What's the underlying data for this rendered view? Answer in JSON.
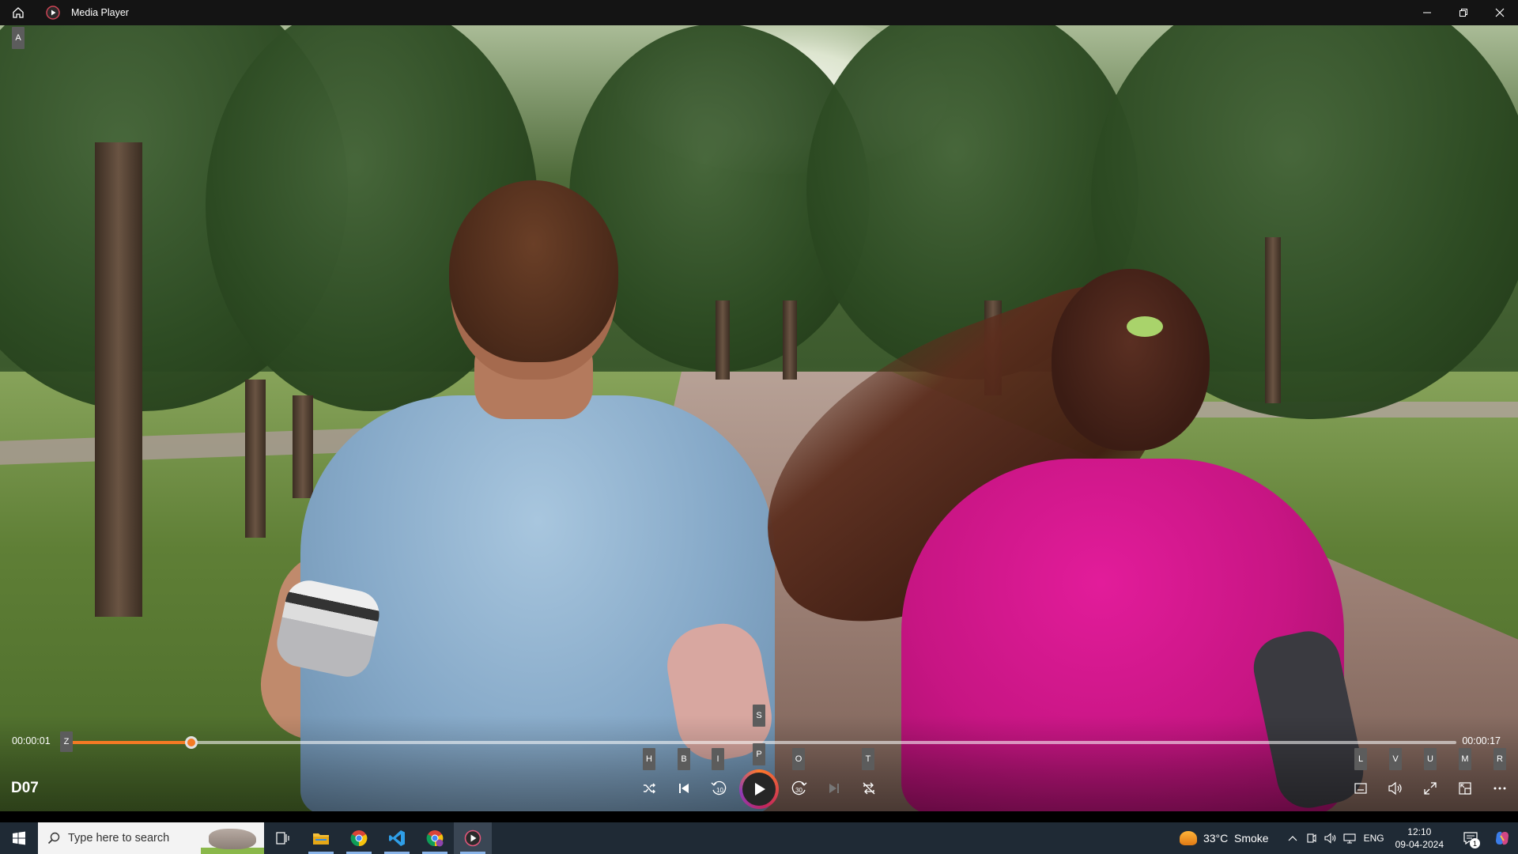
{
  "window": {
    "title": "Media Player"
  },
  "keytips": {
    "A": "A",
    "Z": "Z",
    "S": "S",
    "H": "H",
    "B": "B",
    "I": "I",
    "P": "P",
    "O": "O",
    "T": "T",
    "L": "L",
    "V": "V",
    "U": "U",
    "M": "M",
    "R": "R"
  },
  "player": {
    "elapsed": "00:00:01",
    "total": "00:00:17",
    "progress_fraction": 0.09,
    "media_title": "D07",
    "accent_color": "#f47a24"
  },
  "controls": {
    "left": [
      "shuffle-icon",
      "previous-icon",
      "rewind-10-icon",
      "play-icon",
      "forward-30-icon",
      "next-icon",
      "repeat-off-icon"
    ],
    "right": [
      "captions-icon",
      "volume-icon",
      "fullscreen-icon",
      "mini-player-icon",
      "more-icon"
    ]
  },
  "taskbar": {
    "search_placeholder": "Type here to search",
    "apps": [
      "task-view-icon",
      "file-explorer-icon",
      "chrome-icon",
      "vscode-icon",
      "chrome-profile-icon",
      "media-player-icon"
    ],
    "weather": "33°C  Smoke",
    "language": "ENG",
    "time": "12:10",
    "date": "09-04-2024",
    "notification_count": "1"
  }
}
